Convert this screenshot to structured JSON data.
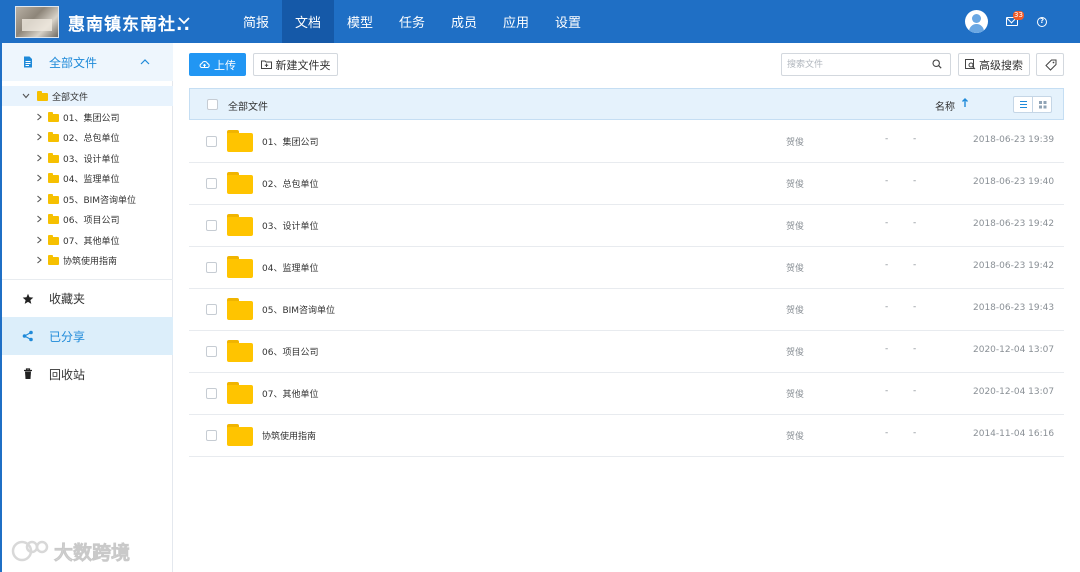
{
  "project": {
    "name": "惠南镇东南社.."
  },
  "nav": {
    "items": [
      {
        "label": "简报"
      },
      {
        "label": "文档"
      },
      {
        "label": "模型"
      },
      {
        "label": "任务"
      },
      {
        "label": "成员"
      },
      {
        "label": "应用"
      },
      {
        "label": "设置"
      }
    ],
    "active_index": 1
  },
  "header": {
    "mail_badge": "33"
  },
  "sidebar": {
    "all_files": "全部文件",
    "favorites": "收藏夹",
    "shared": "已分享",
    "trash": "回收站",
    "tree": {
      "root": "全部文件",
      "children": [
        "01、集团公司",
        "02、总包单位",
        "03、设计单位",
        "04、监理单位",
        "05、BIM咨询单位",
        "06、项目公司",
        "07、其他单位",
        "协筑使用指南"
      ]
    }
  },
  "toolbar": {
    "upload": "上传",
    "new_folder": "新建文件夹",
    "search_placeholder": "搜索文件",
    "advanced_search": "高级搜索"
  },
  "table": {
    "header_all": "全部文件",
    "header_name": "名称",
    "rows": [
      {
        "name": "01、集团公司",
        "owner": "贺俊",
        "col3": "-",
        "col4": "-",
        "date": "2018-06-23 19:39"
      },
      {
        "name": "02、总包单位",
        "owner": "贺俊",
        "col3": "-",
        "col4": "-",
        "date": "2018-06-23 19:40"
      },
      {
        "name": "03、设计单位",
        "owner": "贺俊",
        "col3": "-",
        "col4": "-",
        "date": "2018-06-23 19:42"
      },
      {
        "name": "04、监理单位",
        "owner": "贺俊",
        "col3": "-",
        "col4": "-",
        "date": "2018-06-23 19:42"
      },
      {
        "name": "05、BIM咨询单位",
        "owner": "贺俊",
        "col3": "-",
        "col4": "-",
        "date": "2018-06-23 19:43"
      },
      {
        "name": "06、项目公司",
        "owner": "贺俊",
        "col3": "-",
        "col4": "-",
        "date": "2020-12-04 13:07"
      },
      {
        "name": "07、其他单位",
        "owner": "贺俊",
        "col3": "-",
        "col4": "-",
        "date": "2020-12-04 13:07"
      },
      {
        "name": "协筑使用指南",
        "owner": "贺俊",
        "col3": "-",
        "col4": "-",
        "date": "2014-11-04 16:16"
      }
    ]
  },
  "watermark": "大数跨境",
  "colors": {
    "topbar": "#1f6fc5",
    "accent": "#2196f3",
    "folder": "#ffc400"
  },
  "icons": {
    "all_files": "file-icon",
    "favorites": "star-icon",
    "shared": "share-icon",
    "trash": "trash-icon"
  }
}
